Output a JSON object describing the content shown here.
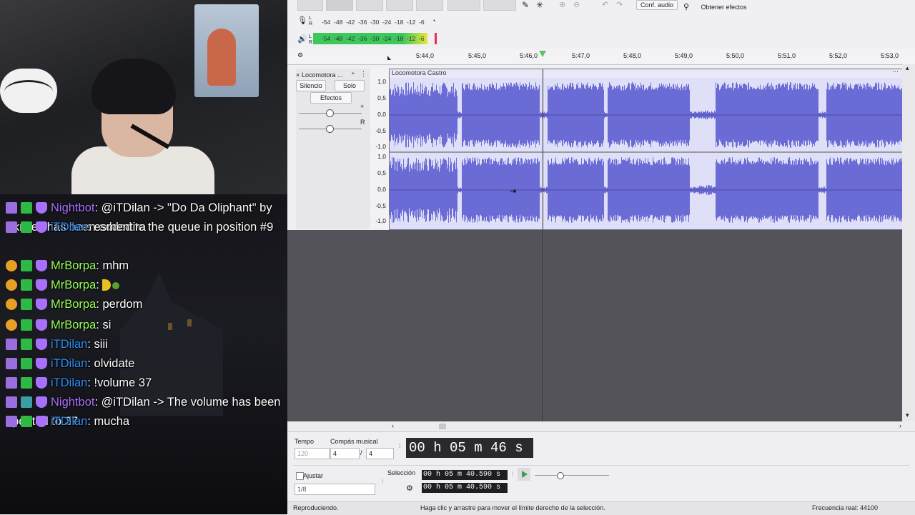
{
  "chat": {
    "messages": [
      {
        "badges": [
          "broad",
          "mod",
          "vip"
        ],
        "user": "Nightbot",
        "color": "#a970ff",
        "sep": ":",
        "text": "@iTDilan -> \"Do Da Oliphant\" by Skrillex has been added to the queue in position #9"
      },
      {
        "badges": [
          "broad",
          "mod",
          "vip"
        ],
        "user": "iTDilan",
        "color": "#2e8ff5",
        "sep": ":",
        "text": "esmentira"
      },
      {
        "badges": [
          "sub",
          "mod",
          "vip"
        ],
        "user": "MrBorpa",
        "color": "#9aff5a",
        "sep": ":",
        "text": "mhm"
      },
      {
        "badges": [
          "sub",
          "mod",
          "vip"
        ],
        "user": "MrBorpa",
        "color": "#9aff5a",
        "sep": ":",
        "text": ""
      },
      {
        "badges": [
          "sub",
          "mod",
          "vip"
        ],
        "user": "MrBorpa",
        "color": "#9aff5a",
        "sep": ":",
        "text": "perdom"
      },
      {
        "badges": [
          "sub",
          "mod",
          "vip"
        ],
        "user": "MrBorpa",
        "color": "#9aff5a",
        "sep": ":",
        "text": "si"
      },
      {
        "badges": [
          "broad",
          "mod",
          "vip"
        ],
        "user": "iTDilan",
        "color": "#2e8ff5",
        "sep": ":",
        "text": "siii"
      },
      {
        "badges": [
          "broad",
          "mod",
          "vip"
        ],
        "user": "iTDilan",
        "color": "#2e8ff5",
        "sep": ":",
        "text": "olvidate"
      },
      {
        "badges": [
          "broad",
          "mod",
          "vip"
        ],
        "user": "iTDilan",
        "color": "#2e8ff5",
        "sep": ":",
        "text": "!volume 37"
      },
      {
        "badges": [
          "broad",
          "bot",
          "vip"
        ],
        "user": "Nightbot",
        "color": "#a970ff",
        "sep": ":",
        "text": "@iTDilan -> The volume has been updated to 37."
      },
      {
        "badges": [
          "broad",
          "mod",
          "vip"
        ],
        "user": "iTDilan",
        "color": "#2e8ff5",
        "sep": ":",
        "text": "mucha"
      }
    ]
  },
  "audacity": {
    "toolbar": {
      "audio_setup": "Conf. audio",
      "get_effects": "Obtener efectos"
    },
    "meters": {
      "record_scale": "-54  -48  -42  -36  -30  -24  -18  -12  -6",
      "play_scale": "-54  -48  -42  -36  -30  -24  -18  -12  -6",
      "lr": [
        "L",
        "R"
      ]
    },
    "timeline": {
      "ticks": [
        "5:44,0",
        "5:45,0",
        "5:46,0",
        "5:47,0",
        "5:48,0",
        "5:49,0",
        "5:50,0",
        "5:51,0",
        "5:52,0",
        "5:53,0"
      ]
    },
    "track": {
      "name": "Locomotora ...",
      "clip_name": "Locomotora Castro",
      "mute": "Silencio",
      "solo": "Solo",
      "effects": "Efectos",
      "pan_r": "R",
      "gain_plus": "+",
      "ruler_labels": [
        "1,0",
        "0,5",
        "0,0",
        "-0,5",
        "-1,0",
        "1,0",
        "0,5",
        "0,0",
        "-0,5",
        "-1,0"
      ]
    },
    "bottom": {
      "tempo_label": "Tempo",
      "tempo_value": "120",
      "time_sig_label": "Compás musical",
      "time_sig_num": "4",
      "time_sig_slash": "/",
      "time_sig_den": "4",
      "big_time": "00 h 05 m 46 s",
      "snap_label": "Ajustar",
      "snap_value": "1/8",
      "selection_label": "Selección",
      "sel_start": "00 h 05 m 40.590 s",
      "sel_end": "00 h 05 m 40.590 s"
    },
    "status": {
      "left": "Reproduciendo.",
      "middle": "Haga clic y arrastre para mover el límite derecho de la selección.",
      "right": "Frecuencia real: 44100"
    },
    "colors": {
      "waveform": "#6b6bd6",
      "wave_bg": "#dfe0f7",
      "meter_green": "#3cc85a",
      "meter_yellow": "#e8e63a"
    }
  }
}
